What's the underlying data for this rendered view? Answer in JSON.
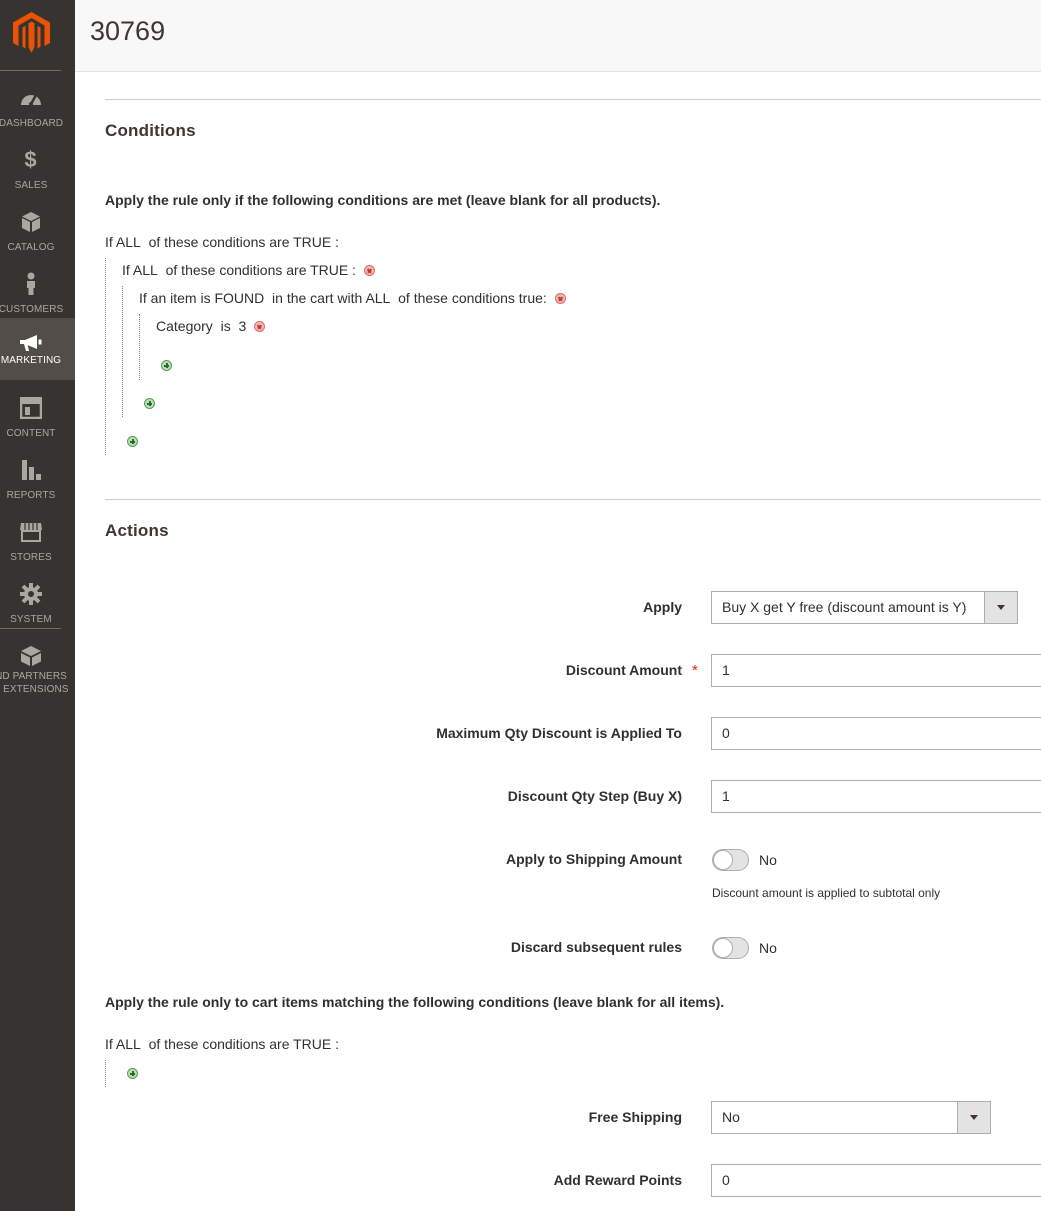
{
  "page": {
    "title": "30769"
  },
  "sidebar": {
    "items": [
      {
        "label": "DASHBOARD",
        "icon": "dashboard-icon"
      },
      {
        "label": "SALES",
        "icon": "dollar-icon"
      },
      {
        "label": "CATALOG",
        "icon": "cube-icon"
      },
      {
        "label": "CUSTOMERS",
        "icon": "person-icon"
      },
      {
        "label": "MARKETING",
        "icon": "megaphone-icon",
        "active": true
      },
      {
        "label": "CONTENT",
        "icon": "layout-icon"
      },
      {
        "label": "REPORTS",
        "icon": "bar-chart-icon"
      },
      {
        "label": "STORES",
        "icon": "store-icon"
      },
      {
        "label": "SYSTEM",
        "icon": "gear-icon"
      },
      {
        "label": "ND PARTNERS",
        "label2": "& EXTENSIONS",
        "icon": "blocks-icon"
      }
    ]
  },
  "conditions": {
    "title": "Conditions",
    "legend": "Apply the rule only if the following conditions are met (leave blank for all products).",
    "root": {
      "prefix": "If",
      "aggregator": "ALL",
      "middle": "of these conditions are",
      "value": "TRUE",
      "suffix": ":"
    },
    "nested": {
      "prefix": "If",
      "aggregator": "ALL",
      "middle": "of these conditions are",
      "value": "TRUE",
      "suffix": ":"
    },
    "found": {
      "prefix": "If an item is",
      "found": "FOUND",
      "middle": "in the cart with",
      "aggregator": "ALL",
      "suffix": "of these conditions true:"
    },
    "category": {
      "attribute": "Category",
      "operator": "is",
      "value": "3"
    }
  },
  "actions": {
    "title": "Actions",
    "apply": {
      "label": "Apply",
      "value": "Buy X get Y free (discount amount is Y)"
    },
    "discount_amount": {
      "label": "Discount Amount",
      "required": "*",
      "value": "1"
    },
    "max_qty": {
      "label": "Maximum Qty Discount is Applied To",
      "value": "0"
    },
    "qty_step": {
      "label": "Discount Qty Step (Buy X)",
      "value": "1"
    },
    "apply_shipping": {
      "label": "Apply to Shipping Amount",
      "state": "No",
      "note": "Discount amount is applied to subtotal only"
    },
    "discard": {
      "label": "Discard subsequent rules",
      "state": "No"
    },
    "items_legend": "Apply the rule only to cart items matching the following conditions (leave blank for all items).",
    "items_root": {
      "prefix": "If",
      "aggregator": "ALL",
      "middle": "of these conditions are",
      "value": "TRUE",
      "suffix": ":"
    },
    "free_shipping": {
      "label": "Free Shipping",
      "value": "No"
    },
    "reward_points": {
      "label": "Add Reward Points",
      "value": "0"
    }
  },
  "colors": {
    "sidebar": "#373330",
    "sidebar_active": "#524d49",
    "logo": "#eb5202",
    "required": "#e22626"
  }
}
